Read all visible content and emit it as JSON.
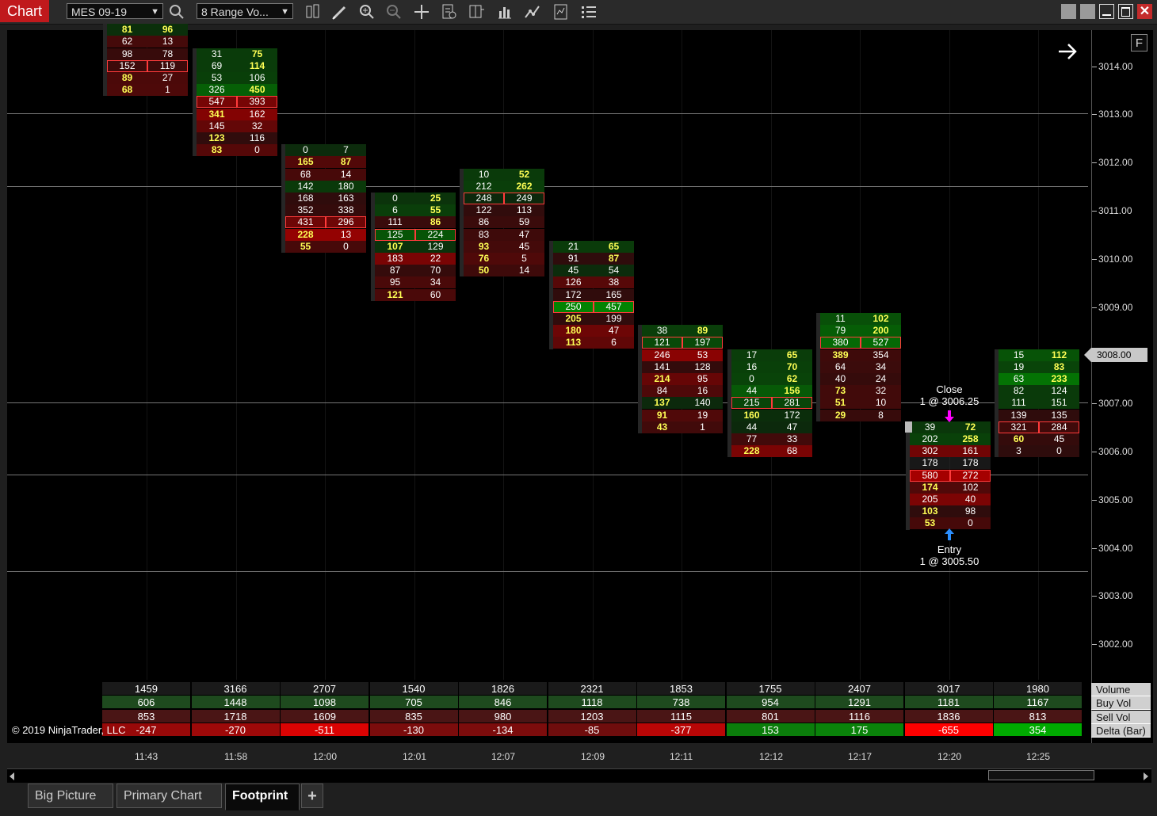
{
  "window": {
    "title": "Chart",
    "instrument": "MES 09-19",
    "bar_type": "8 Range Vo..."
  },
  "toolbar": {
    "icons": [
      "search-icon",
      "bars-icon",
      "pencil-icon",
      "zoom-in-icon",
      "zoom-out-icon",
      "crosshair-icon",
      "properties-icon",
      "templates-icon",
      "indicators-icon",
      "strategies-icon",
      "data-box-icon",
      "menu-icon"
    ],
    "window_buttons": [
      "restore-icon",
      "restore-icon",
      "minimize-icon",
      "maximize-icon",
      "close-icon"
    ]
  },
  "colors": {
    "accent_red": "#c0191c",
    "poc_yellow": "#ffff55",
    "bid_red": "#8b0000",
    "ask_green": "#1e7b1e"
  },
  "price_axis": {
    "labels": [
      "3014.00",
      "3013.00",
      "3012.00",
      "3011.00",
      "3010.00",
      "3009.00",
      "3008.00",
      "3007.00",
      "3006.00",
      "3005.00",
      "3004.00",
      "3003.00",
      "3002.00"
    ],
    "current_price": "3008.00"
  },
  "f_button": "F",
  "footprint_bars": [
    {
      "time": "11:43",
      "top_price": 3014.75,
      "rows": [
        [
          "81",
          "96"
        ],
        [
          "62",
          "13"
        ],
        [
          "98",
          "78"
        ],
        [
          "152",
          "119"
        ],
        [
          "89",
          "27"
        ],
        [
          "68",
          "1"
        ]
      ]
    },
    {
      "time": "11:58",
      "top_price": 3014.25,
      "rows": [
        [
          "31",
          "75"
        ],
        [
          "69",
          "114"
        ],
        [
          "53",
          "106"
        ],
        [
          "326",
          "450"
        ],
        [
          "547",
          "393"
        ],
        [
          "341",
          "162"
        ],
        [
          "145",
          "32"
        ],
        [
          "123",
          "116"
        ],
        [
          "83",
          "0"
        ]
      ]
    },
    {
      "time": "12:00",
      "top_price": 3012.25,
      "rows": [
        [
          "0",
          "7"
        ],
        [
          "165",
          "87"
        ],
        [
          "68",
          "14"
        ],
        [
          "142",
          "180"
        ],
        [
          "168",
          "163"
        ],
        [
          "352",
          "338"
        ],
        [
          "431",
          "296"
        ],
        [
          "228",
          "13"
        ],
        [
          "55",
          "0"
        ]
      ]
    },
    {
      "time": "12:01",
      "top_price": 3011.25,
      "rows": [
        [
          "0",
          "25"
        ],
        [
          "6",
          "55"
        ],
        [
          "111",
          "86"
        ],
        [
          "125",
          "224"
        ],
        [
          "107",
          "129"
        ],
        [
          "183",
          "22"
        ],
        [
          "87",
          "70"
        ],
        [
          "95",
          "34"
        ],
        [
          "121",
          "60"
        ]
      ]
    },
    {
      "time": "12:07",
      "top_price": 3011.75,
      "rows": [
        [
          "10",
          "52"
        ],
        [
          "212",
          "262"
        ],
        [
          "248",
          "249"
        ],
        [
          "122",
          "113"
        ],
        [
          "86",
          "59"
        ],
        [
          "83",
          "47"
        ],
        [
          "93",
          "45"
        ],
        [
          "76",
          "5"
        ],
        [
          "50",
          "14"
        ]
      ]
    },
    {
      "time": "12:09",
      "top_price": 3010.25,
      "rows": [
        [
          "21",
          "65"
        ],
        [
          "91",
          "87"
        ],
        [
          "45",
          "54"
        ],
        [
          "126",
          "38"
        ],
        [
          "172",
          "165"
        ],
        [
          "250",
          "457"
        ],
        [
          "205",
          "199"
        ],
        [
          "180",
          "47"
        ],
        [
          "113",
          "6"
        ]
      ]
    },
    {
      "time": "12:11",
      "top_price": 3008.5,
      "rows": [
        [
          "38",
          "89"
        ],
        [
          "121",
          "197"
        ],
        [
          "246",
          "53"
        ],
        [
          "141",
          "128"
        ],
        [
          "214",
          "95"
        ],
        [
          "84",
          "16"
        ],
        [
          "137",
          "140"
        ],
        [
          "91",
          "19"
        ],
        [
          "43",
          "1"
        ]
      ]
    },
    {
      "time": "12:12",
      "top_price": 3008.0,
      "rows": [
        [
          "17",
          "65"
        ],
        [
          "16",
          "70"
        ],
        [
          "0",
          "62"
        ],
        [
          "44",
          "156"
        ],
        [
          "215",
          "281"
        ],
        [
          "160",
          "172"
        ],
        [
          "44",
          "47"
        ],
        [
          "77",
          "33"
        ],
        [
          "228",
          "68"
        ]
      ]
    },
    {
      "time": "12:17",
      "top_price": 3008.75,
      "rows": [
        [
          "11",
          "102"
        ],
        [
          "79",
          "200"
        ],
        [
          "380",
          "527"
        ],
        [
          "389",
          "354"
        ],
        [
          "64",
          "34"
        ],
        [
          "40",
          "24"
        ],
        [
          "73",
          "32"
        ],
        [
          "51",
          "10"
        ],
        [
          "29",
          "8"
        ]
      ]
    },
    {
      "time": "12:20",
      "top_price": 3006.5,
      "rows": [
        [
          "39",
          "72"
        ],
        [
          "202",
          "258"
        ],
        [
          "302",
          "161"
        ],
        [
          "178",
          "178"
        ],
        [
          "580",
          "272"
        ],
        [
          "174",
          "102"
        ],
        [
          "205",
          "40"
        ],
        [
          "103",
          "98"
        ],
        [
          "53",
          "0"
        ]
      ]
    },
    {
      "time": "12:25",
      "top_price": 3008.0,
      "rows": [
        [
          "15",
          "112"
        ],
        [
          "19",
          "83"
        ],
        [
          "63",
          "233"
        ],
        [
          "82",
          "124"
        ],
        [
          "111",
          "151"
        ],
        [
          "139",
          "135"
        ],
        [
          "321",
          "284"
        ],
        [
          "60",
          "45"
        ],
        [
          "3",
          "0"
        ]
      ]
    }
  ],
  "trades": {
    "close": {
      "line1": "Close",
      "line2": "1 @ 3006.25"
    },
    "entry": {
      "line1": "Entry",
      "line2": "1 @ 3005.50"
    }
  },
  "summary": {
    "labels": [
      "Volume",
      "Buy Vol",
      "Sell Vol",
      "Delta (Bar)"
    ],
    "volume": [
      "1459",
      "3166",
      "2707",
      "1540",
      "1826",
      "2321",
      "1853",
      "1755",
      "2407",
      "3017",
      "1980"
    ],
    "buy_vol": [
      "606",
      "1448",
      "1098",
      "705",
      "846",
      "1118",
      "738",
      "954",
      "1291",
      "1181",
      "1167"
    ],
    "sell_vol": [
      "853",
      "1718",
      "1609",
      "835",
      "980",
      "1203",
      "1115",
      "801",
      "1116",
      "1836",
      "813"
    ],
    "delta": [
      "-247",
      "-270",
      "-511",
      "-130",
      "-134",
      "-85",
      "-377",
      "153",
      "175",
      "-655",
      "354"
    ]
  },
  "copyright": "© 2019 NinjaTrader, LLC",
  "time_labels": [
    "11:43",
    "11:58",
    "12:00",
    "12:01",
    "12:07",
    "12:09",
    "12:11",
    "12:12",
    "12:17",
    "12:20",
    "12:25"
  ],
  "tabs": [
    "Big Picture",
    "Primary Chart",
    "Footprint",
    "+"
  ]
}
